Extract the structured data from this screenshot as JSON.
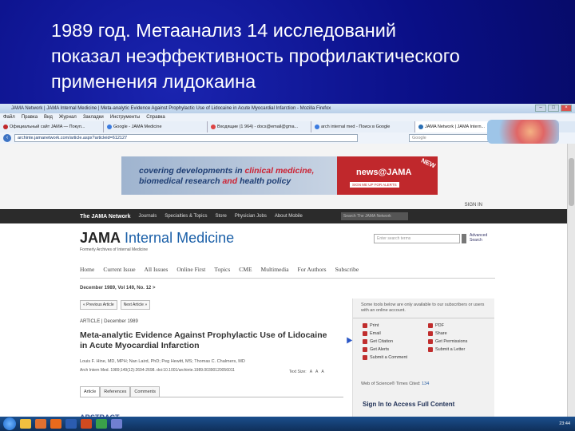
{
  "slide": {
    "title_lines": [
      "1989 год. Метаанализ 14 исследований",
      "показал неэффективность профилактического",
      "применения лидокаина"
    ]
  },
  "browser": {
    "window_title": "JAMA Network | JAMA Internal Medicine | Meta-analytic Evidence Against Prophylactic Use of Lidocaine in Acute Myocardial Infarction - Mozilla Firefox",
    "menu": [
      "Файл",
      "Правка",
      "Вид",
      "Журнал",
      "Закладки",
      "Инструменты",
      "Справка"
    ],
    "tabs": [
      {
        "label": "Официальный сайт JAMA — Покуп...",
        "color": "#c0282c"
      },
      {
        "label": "Google - JAMA Medicine",
        "color": "#3b7be0"
      },
      {
        "label": "Входящие (1 964) - docs@email@gma...",
        "color": "#d44"
      },
      {
        "label": "arch internal med - Поиск в Google",
        "color": "#3b7be0"
      },
      {
        "label": "JAMA Network | JAMA Intern...",
        "color": "#2a6fb4"
      }
    ],
    "url": "archinte.jamanetwork.com/article.aspx?articleid=612127",
    "search_placeholder": "Google"
  },
  "page": {
    "ad": {
      "line1_a": "covering developments in ",
      "line1_b": "clinical medicine,",
      "line2_a": "biomedical research ",
      "line2_b": "and ",
      "line2_c": "health policy",
      "news_label": "news@JAMA",
      "signup_label": "SIGN ME UP FOR ALERTS",
      "new_badge": "NEW"
    },
    "signin": "SIGN IN",
    "jnav": {
      "brand": "The JAMA Network",
      "items": [
        "Journals",
        "Specialties & Topics",
        "Store",
        "Physician Jobs",
        "About Mobile"
      ],
      "search_placeholder": "Search The JAMA Network"
    },
    "logo": {
      "jama": "JAMA",
      "im": "Internal Medicine",
      "sub": "Formerly Archives of Internal Medicine"
    },
    "site_search_placeholder": "Enter search terms",
    "advanced_search": "Advanced Search",
    "mainnav": [
      "Home",
      "Current Issue",
      "All Issues",
      "Online First",
      "Topics",
      "CME",
      "Multimedia",
      "For Authors",
      "Subscribe"
    ],
    "issue": "December 1989, Vol 149, No. 12 >",
    "artnav": [
      "« Previous Article",
      "Next Article »"
    ],
    "article_label": "ARTICLE  |  December 1989",
    "article_title": "Meta-analytic Evidence Against Prophylactic Use of Lidocaine in Acute Myocardial Infarction",
    "authors": "Louis F. Hine, MD, MPH; Nan Laird, PhD; Peg Hewitt, MS; Thomas C. Chalmers, MD",
    "citation": "Arch Intern Med. 1989;149(12):2694-2698. doi:10.1001/archinte.1989.00390120056011",
    "tools": [
      "Text Size:",
      "A",
      "A",
      "A"
    ],
    "subtabs": [
      "Article",
      "References",
      "Comments"
    ],
    "abstract": "ABSTRACT",
    "sidebar": {
      "note": "Some tools below are only available to our subscribers or users with an online account.",
      "items": [
        "Print",
        "PDF",
        "Email",
        "Share",
        "Get Citation",
        "Get Permissions",
        "Get Alerts",
        "Submit a Letter",
        "Submit a Comment"
      ],
      "wos_label": "Web of Science® Times Cited: ",
      "wos_count": "134",
      "access": "Sign In to Access Full Content"
    }
  },
  "taskbar": {
    "clock": "23:44"
  }
}
